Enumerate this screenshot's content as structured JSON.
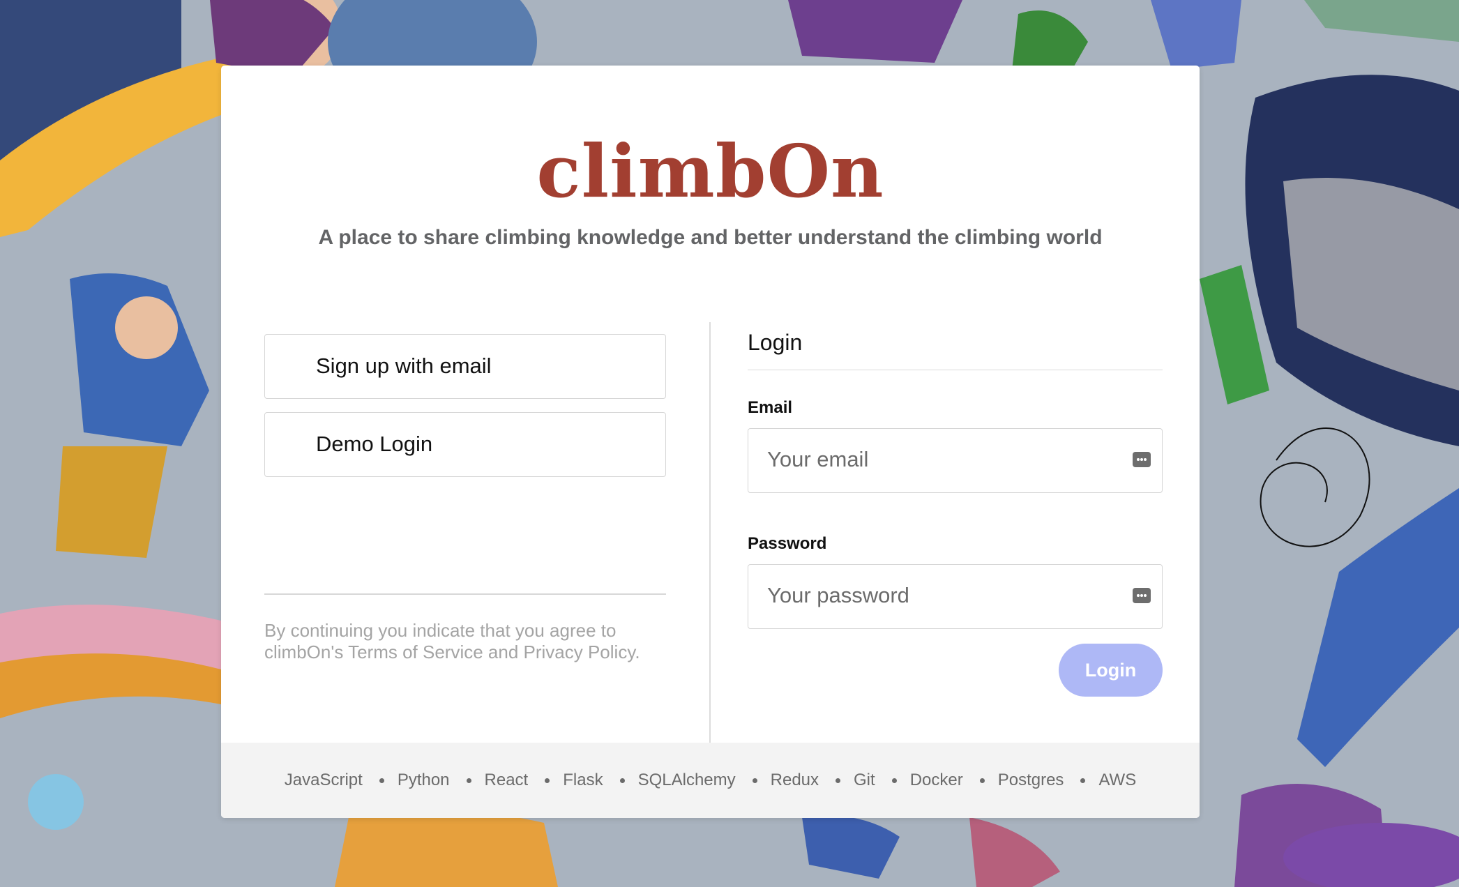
{
  "brand": {
    "title": "climbOn",
    "tagline": "A place to share climbing knowledge and better understand the climbing world"
  },
  "signup": {
    "email_button_label": "Sign up with email",
    "demo_button_label": "Demo Login",
    "terms_text": "By continuing you indicate that you agree to climbOn's Terms of Service and Privacy Policy."
  },
  "login": {
    "heading": "Login",
    "email_label": "Email",
    "email_placeholder": "Your email",
    "email_value": "",
    "password_label": "Password",
    "password_placeholder": "Your password",
    "password_value": "",
    "submit_label": "Login"
  },
  "footer": {
    "technologies": [
      "JavaScript",
      "Python",
      "React",
      "Flask",
      "SQLAlchemy",
      "Redux",
      "Git",
      "Docker",
      "Postgres",
      "AWS"
    ]
  },
  "colors": {
    "brand": "#a23f31",
    "login_button": "#aeb8f6",
    "footer_bg": "#f3f3f3"
  },
  "icons": {
    "input_autofill": "password-manager-key-icon"
  }
}
